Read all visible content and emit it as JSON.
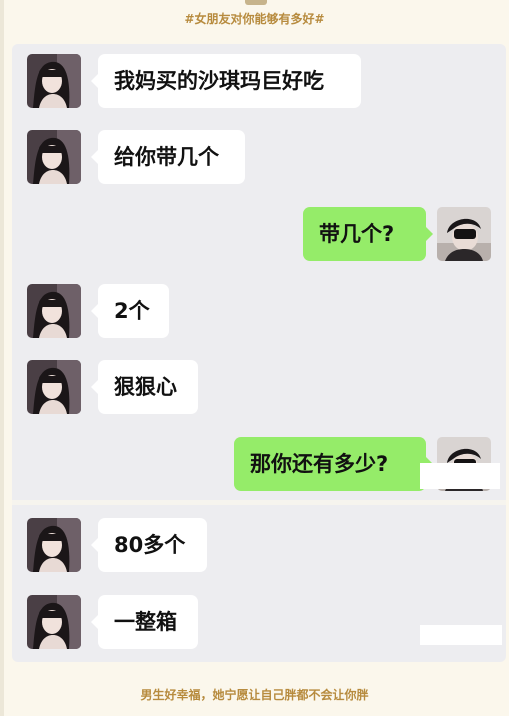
{
  "header": {
    "hashtag": "#女朋友对你能够有多好#"
  },
  "chat": {
    "messages": [
      {
        "side": "left",
        "text": "我妈买的沙琪玛巨好吃"
      },
      {
        "side": "left",
        "text": "给你带几个"
      },
      {
        "side": "right",
        "text": "带几个?"
      },
      {
        "side": "left",
        "text": "2个"
      },
      {
        "side": "left",
        "text": "狠狠心"
      },
      {
        "side": "right",
        "text": "那你还有多少?"
      },
      {
        "side": "left",
        "text": "80多个"
      },
      {
        "side": "left",
        "text": "一整箱"
      }
    ]
  },
  "footer": {
    "caption": "男生好幸福，她宁愿让自己胖都不会让你胖"
  },
  "colors": {
    "page_bg": "#fbf7ec",
    "chat_bg": "#ededf0",
    "bubble_left": "#ffffff",
    "bubble_right": "#95ec69",
    "caption": "#b78b3e"
  },
  "icons": {
    "girl_avatar": "girl-avatar-icon",
    "boy_avatar": "boy-avatar-icon"
  }
}
